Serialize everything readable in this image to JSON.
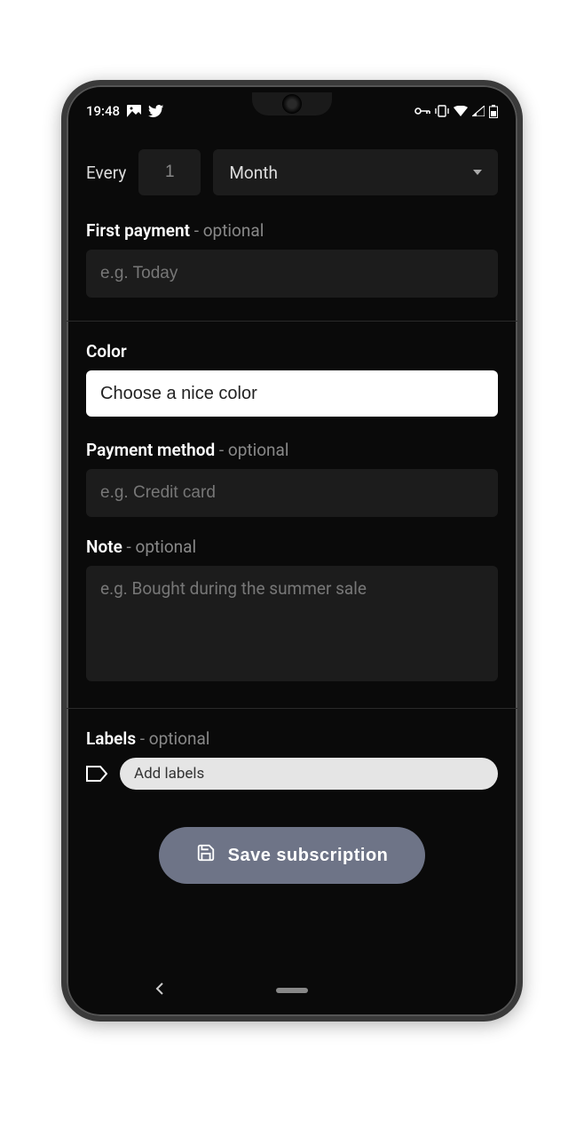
{
  "status": {
    "time": "19:48"
  },
  "recurrence": {
    "every_label": "Every",
    "interval_value": "1",
    "unit_selected": "Month"
  },
  "first_payment": {
    "label": "First payment",
    "optional": " - optional",
    "placeholder": "e.g. Today"
  },
  "color": {
    "label": "Color",
    "button_text": "Choose a nice color"
  },
  "payment_method": {
    "label": "Payment method",
    "optional": " - optional",
    "placeholder": "e.g. Credit card"
  },
  "note": {
    "label": "Note",
    "optional": " - optional",
    "placeholder": "e.g. Bought during the summer sale"
  },
  "labels": {
    "label": "Labels",
    "optional": " - optional",
    "add_text": "Add labels"
  },
  "save_button": "Save subscription"
}
